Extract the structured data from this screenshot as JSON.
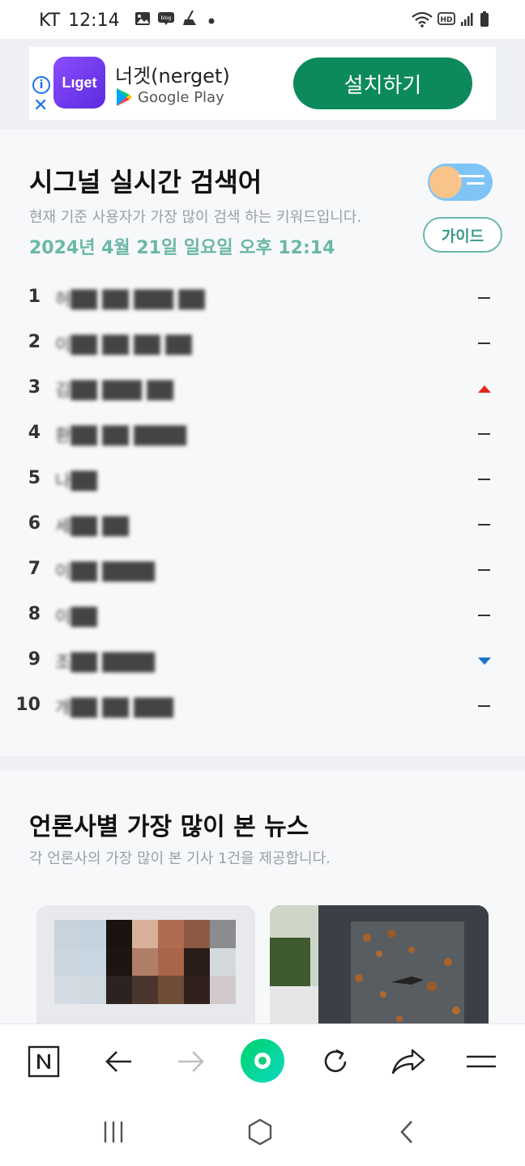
{
  "status_bar": {
    "carrier": "KT",
    "time": "12:14",
    "icons": [
      "gallery-icon",
      "blog-icon",
      "broom-icon",
      "dot-icon",
      "wifi-icon",
      "hd-icon",
      "signal-icon",
      "battery-icon"
    ],
    "hd_label": "HD"
  },
  "ad": {
    "app_logo_text": "Lıget",
    "app_name": "너겟(nerget)",
    "store_label": "Google Play",
    "install_label": "설치하기",
    "install_color": "#0d8a5b"
  },
  "signal": {
    "title": "시그널 실시간 검색어",
    "subtitle": "현재 기준 사용자가 가장 많이 검색 하는 키워드입니다.",
    "datetime": "2024년 4월 21일 일요일 오후 12:14",
    "guide_label": "가이드",
    "accent_color": "#6bb7a8",
    "ranks": [
      {
        "rank": "1",
        "keyword": "허██ ██ ███ ██",
        "trend": "flat"
      },
      {
        "rank": "2",
        "keyword": "이██ ██ ██ ██",
        "trend": "flat"
      },
      {
        "rank": "3",
        "keyword": "김██ ███ ██",
        "trend": "up"
      },
      {
        "rank": "4",
        "keyword": "환██ ██ ████",
        "trend": "flat"
      },
      {
        "rank": "5",
        "keyword": "나██",
        "trend": "flat"
      },
      {
        "rank": "6",
        "keyword": "세██ ██",
        "trend": "flat"
      },
      {
        "rank": "7",
        "keyword": "이██ ████",
        "trend": "flat"
      },
      {
        "rank": "8",
        "keyword": "이██",
        "trend": "flat"
      },
      {
        "rank": "9",
        "keyword": "조██ ████",
        "trend": "down"
      },
      {
        "rank": "10",
        "keyword": "개██ ██ ███",
        "trend": "flat"
      }
    ]
  },
  "news": {
    "title": "언론사별 가장 많이 본 뉴스",
    "subtitle": "각 언론사의 가장 많이 본 기사 1건을 제공합니다."
  },
  "toolbar": {
    "items": [
      "naver-icon",
      "back-icon",
      "forward-icon",
      "home-icon",
      "refresh-icon",
      "share-icon",
      "menu-icon"
    ]
  },
  "system_nav": {
    "items": [
      "recent-apps-icon",
      "home-icon",
      "back-icon"
    ]
  }
}
